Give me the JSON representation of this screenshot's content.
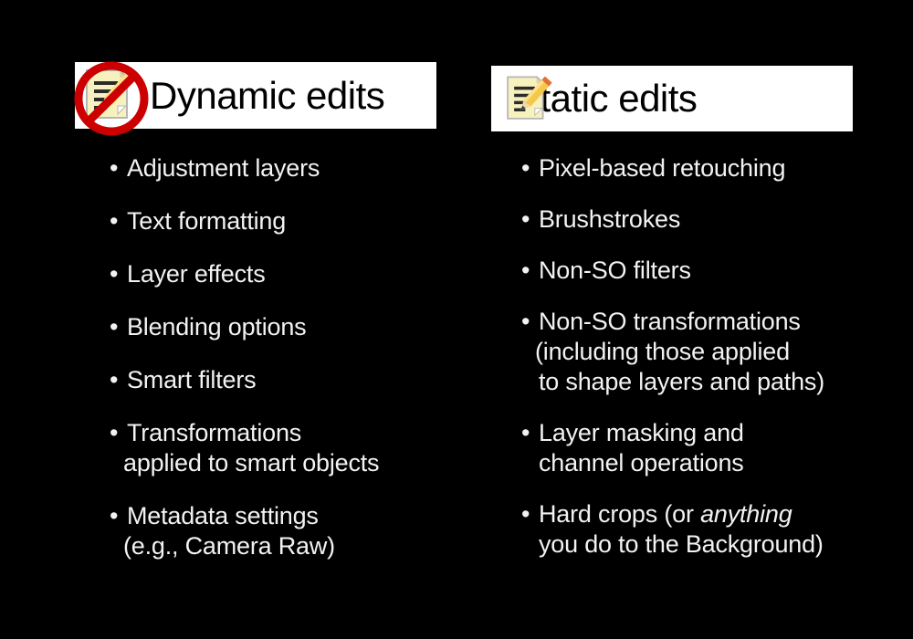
{
  "slide": {
    "background_color": "#000000",
    "text_color": "#f2f2f2",
    "band_color": "#ffffff",
    "band_text_color": "#000000"
  },
  "columns": [
    {
      "id": "dynamic",
      "title": "Dynamic edits",
      "icon": "memo-pencil-prohibited-icon",
      "bullet_char": "•",
      "items": [
        {
          "line1": "Adjustment layers"
        },
        {
          "line1": "Text formatting"
        },
        {
          "line1": "Layer effects"
        },
        {
          "line1": "Blending options"
        },
        {
          "line1": "Smart filters"
        },
        {
          "line1": "Transformations",
          "line2": "applied to smart objects"
        },
        {
          "line1": "Metadata settings",
          "line2": "(e.g., Camera Raw)"
        }
      ]
    },
    {
      "id": "static",
      "title": "Static edits",
      "icon": "memo-pencil-icon",
      "bullet_char": "•",
      "items": [
        {
          "line1": "Pixel-based retouching"
        },
        {
          "line1": "Brushstrokes"
        },
        {
          "line1": "Non-SO filters"
        },
        {
          "line1": "Non-SO transformations",
          "line2": "(including those applied",
          "line3": "to shape layers and paths)"
        },
        {
          "line1": "Layer masking and",
          "line2": "channel operations"
        },
        {
          "line1": "Hard crops (or ",
          "line1_italic": "anything",
          "line1_tail": "",
          "line2": "you do to the Background)"
        }
      ]
    }
  ]
}
